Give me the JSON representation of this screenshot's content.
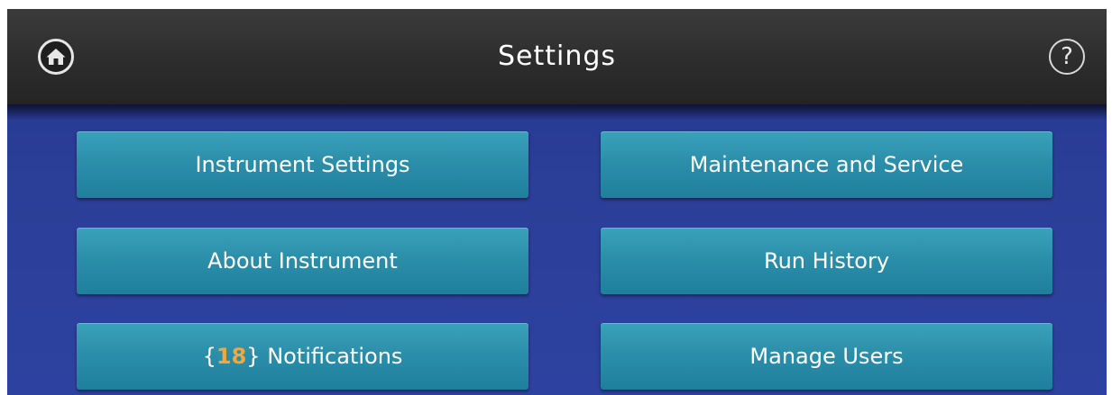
{
  "header": {
    "title": "Settings",
    "home_icon": "home-icon",
    "help_icon": "help-icon",
    "help_glyph": "?"
  },
  "menu": {
    "instrument_settings": "Instrument Settings",
    "maintenance_and_service": "Maintenance and Service",
    "about_instrument": "About Instrument",
    "run_history": "Run History",
    "notifications": {
      "open_brace": "{",
      "count": "18",
      "close_brace": "}",
      "label": " Notifications"
    },
    "manage_users": "Manage Users"
  },
  "colors": {
    "background": "#2b3e98",
    "header": "#2d2d2d",
    "tile": "#2c8faa",
    "notification_count": "#f3a63a"
  }
}
